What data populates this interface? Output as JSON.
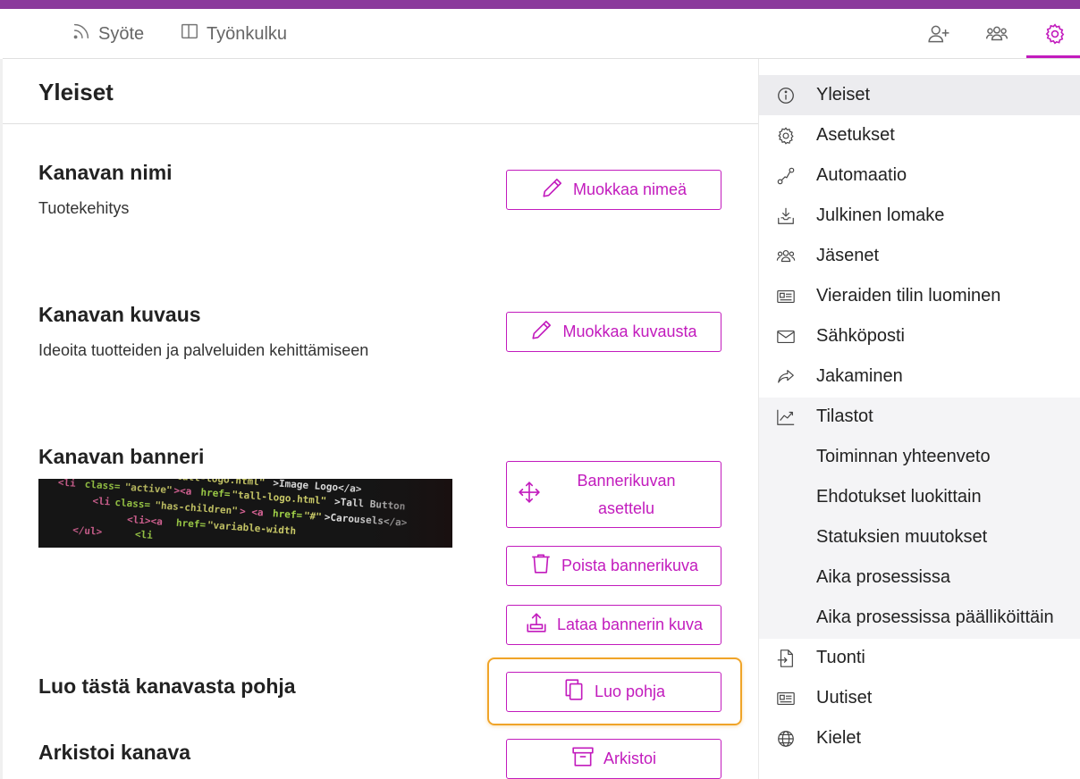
{
  "header": {
    "tabs": [
      {
        "label": "Syöte",
        "icon": "rss-feed-icon"
      },
      {
        "label": "Työnkulku",
        "icon": "board-columns-icon"
      }
    ],
    "right_icons": [
      "add-user-icon",
      "members-group-icon",
      "settings-gear-icon"
    ],
    "accent": "#c21bbd",
    "topbar_color": "#8b3a9c"
  },
  "main": {
    "title": "Yleiset",
    "sections": {
      "name": {
        "title": "Kanavan nimi",
        "value": "Tuotekehitys",
        "button": "Muokkaa nimeä"
      },
      "description": {
        "title": "Kanavan kuvaus",
        "value": "Ideoita tuotteiden ja palveluiden kehittämiseen",
        "button": "Muokkaa kuvausta"
      },
      "banner": {
        "title": "Kanavan banneri",
        "layout_button": "Bannerikuvan asettelu",
        "delete_button": "Poista bannerikuva",
        "upload_button": "Lataa bannerin kuva"
      },
      "template": {
        "title": "Luo tästä kanavasta pohja",
        "button": "Luo pohja"
      },
      "archive": {
        "title": "Arkistoi kanava",
        "button": "Arkistoi"
      }
    }
  },
  "sidebar": {
    "items": [
      {
        "label": "Yleiset",
        "icon": "info-icon"
      },
      {
        "label": "Asetukset",
        "icon": "gear-icon"
      },
      {
        "label": "Automaatio",
        "icon": "automation-icon"
      },
      {
        "label": "Julkinen lomake",
        "icon": "inbox-download-icon"
      },
      {
        "label": "Jäsenet",
        "icon": "members-icon"
      },
      {
        "label": "Vieraiden tilin luominen",
        "icon": "id-card-icon"
      },
      {
        "label": "Sähköposti",
        "icon": "mail-icon"
      },
      {
        "label": "Jakaminen",
        "icon": "share-arrow-icon"
      },
      {
        "label": "Tilastot",
        "icon": "chart-line-icon"
      },
      {
        "label": "Toiminnan yhteenveto",
        "icon": ""
      },
      {
        "label": "Ehdotukset luokittain",
        "icon": ""
      },
      {
        "label": "Statuksien muutokset",
        "icon": ""
      },
      {
        "label": "Aika prosessissa",
        "icon": ""
      },
      {
        "label": "Aika prosessissa päälliköittäin",
        "icon": ""
      },
      {
        "label": "Tuonti",
        "icon": "import-file-icon"
      },
      {
        "label": "Uutiset",
        "icon": "newspaper-icon"
      },
      {
        "label": "Kielet",
        "icon": "globe-icon"
      }
    ]
  }
}
